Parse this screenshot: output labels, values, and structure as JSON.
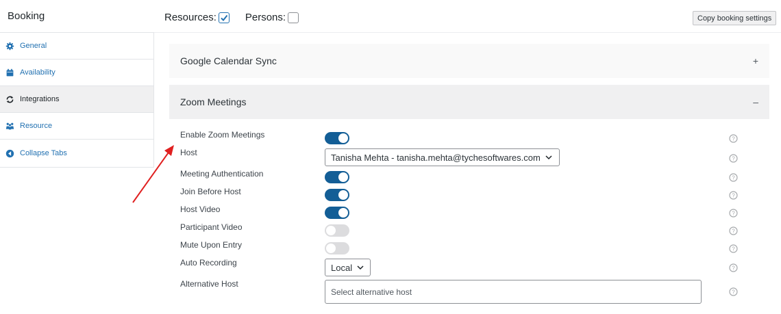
{
  "header": {
    "title": "Booking",
    "resources_label": "Resources:",
    "resources_checked": true,
    "persons_label": "Persons:",
    "persons_checked": false,
    "copy_button": "Copy booking settings"
  },
  "sidebar": {
    "items": [
      {
        "label": "General",
        "icon": "gear-icon",
        "active": false
      },
      {
        "label": "Availability",
        "icon": "calendar-icon",
        "active": false
      },
      {
        "label": "Integrations",
        "icon": "sync-icon",
        "active": true
      },
      {
        "label": "Resource",
        "icon": "people-icon",
        "active": false
      },
      {
        "label": "Collapse Tabs",
        "icon": "collapse-arrow-icon",
        "active": false
      }
    ]
  },
  "panels": {
    "google": {
      "title": "Google Calendar Sync",
      "sign": "+"
    },
    "zoom": {
      "title": "Zoom Meetings",
      "sign": "–"
    }
  },
  "zoom_settings": {
    "enable_label": "Enable Zoom Meetings",
    "enable_on": true,
    "host_label": "Host",
    "host_value": "Tanisha Mehta - tanisha.mehta@tychesoftwares.com",
    "auth_label": "Meeting Authentication",
    "auth_on": true,
    "join_label": "Join Before Host",
    "join_on": true,
    "host_video_label": "Host Video",
    "host_video_on": true,
    "participant_video_label": "Participant Video",
    "participant_video_on": false,
    "mute_label": "Mute Upon Entry",
    "mute_on": false,
    "recording_label": "Auto Recording",
    "recording_value": "Local",
    "alt_host_label": "Alternative Host",
    "alt_host_placeholder": "Select alternative host"
  },
  "colors": {
    "accent": "#2271b1",
    "toggle_on": "#135e96",
    "toggle_off": "#dcdcde",
    "arrow": "#e02020"
  }
}
